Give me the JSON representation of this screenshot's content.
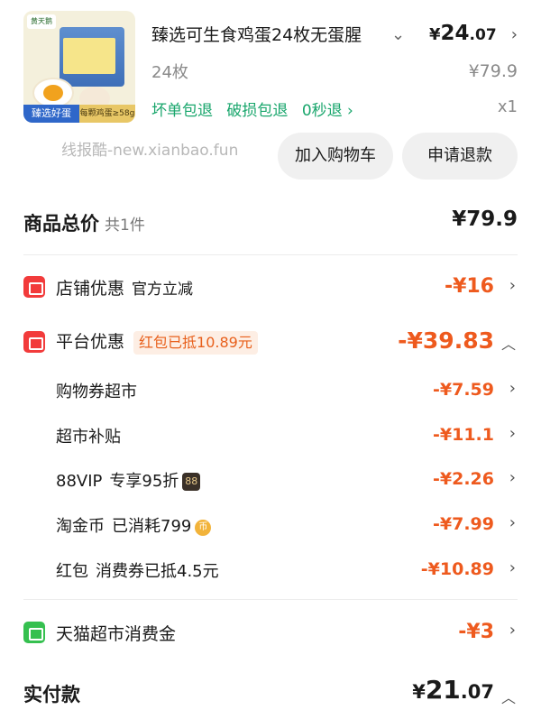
{
  "product": {
    "thumb_brand": "黄天鹅",
    "thumb_tag_left": "臻选好蛋",
    "thumb_tag_right": "每颗鸡蛋≥58g",
    "title": "臻选可生食鸡蛋24枚无蛋腥",
    "price_yen": "¥",
    "price_int": "24",
    "price_dec": ".07",
    "spec": "24枚",
    "original_price": "¥79.9",
    "perks": [
      "坏单包退",
      "破损包退",
      "0秒退 ›"
    ],
    "quantity": "x1"
  },
  "watermark": "线报酷-new.xianbao.fun",
  "actions": {
    "add_to_cart": "加入购物车",
    "refund": "申请退款"
  },
  "summary": {
    "goods_total_label": "商品总价",
    "goods_count": "共1件",
    "goods_total": "¥79.9",
    "shop_discount": {
      "label": "店铺优惠",
      "note": "官方立减",
      "amount": "-¥16"
    },
    "platform_discount": {
      "label": "平台优惠",
      "pill": "红包已抵10.89元",
      "amount": "-¥39.83",
      "items": [
        {
          "label": "购物券",
          "note": "超市",
          "amount": "-¥7.59"
        },
        {
          "label": "超市补贴",
          "note": "",
          "amount": "-¥11.1"
        },
        {
          "label": "88VIP",
          "note": "专享95折",
          "badge": "88",
          "amount": "-¥2.26"
        },
        {
          "label": "淘金币",
          "note": "已消耗799",
          "coin": "币",
          "amount": "-¥7.99"
        },
        {
          "label": "红包",
          "note": "消费券已抵4.5元",
          "amount": "-¥10.89"
        }
      ]
    },
    "tmall_credit": {
      "label": "天猫超市消费金",
      "amount": "-¥3"
    },
    "paid_label": "实付款",
    "paid_yen": "¥",
    "paid_int": "21",
    "paid_dec": ".07"
  },
  "colors": {
    "accent_orange": "#ee5a1e",
    "perk_green": "#19a66c",
    "icon_red": "#f23b3b",
    "icon_green": "#35c04f"
  },
  "icons": [
    "chevron-down-icon",
    "chevron-right-icon",
    "chevron-up-icon",
    "shop-icon",
    "coupon-icon",
    "wallet-icon"
  ]
}
